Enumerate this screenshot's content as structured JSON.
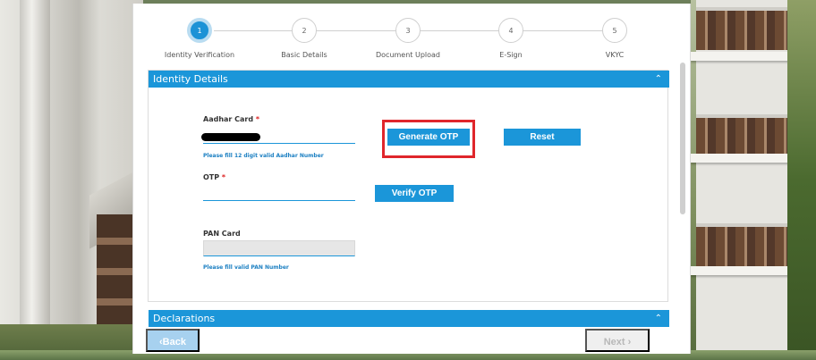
{
  "stepper": {
    "steps": [
      {
        "number": "1",
        "label": "Identity Verification"
      },
      {
        "number": "2",
        "label": "Basic Details"
      },
      {
        "number": "3",
        "label": "Document Upload"
      },
      {
        "number": "4",
        "label": "E-Sign"
      },
      {
        "number": "5",
        "label": "VKYC"
      }
    ],
    "active_step": 1
  },
  "identity_section": {
    "title": "Identity Details",
    "aadhar": {
      "label": "Aadhar Card",
      "required_mark": "*",
      "hint": "Please fill 12 digit valid Aadhar Number"
    },
    "otp": {
      "label": "OTP",
      "required_mark": "*",
      "value": ""
    },
    "pan": {
      "label": "PAN Card",
      "value": "",
      "hint": "Please fill valid PAN Number"
    },
    "buttons": {
      "generate_otp": "Generate OTP",
      "reset": "Reset",
      "verify_otp": "Verify OTP"
    }
  },
  "declarations_section": {
    "title": "Declarations"
  },
  "navigation": {
    "back": "‹Back",
    "next": "Next ›"
  },
  "colors": {
    "accent": "#1b96d9",
    "highlight": "#e0262b",
    "required": "#dd2222"
  },
  "icons": {
    "section_toggle": "chevron-up-icon"
  }
}
